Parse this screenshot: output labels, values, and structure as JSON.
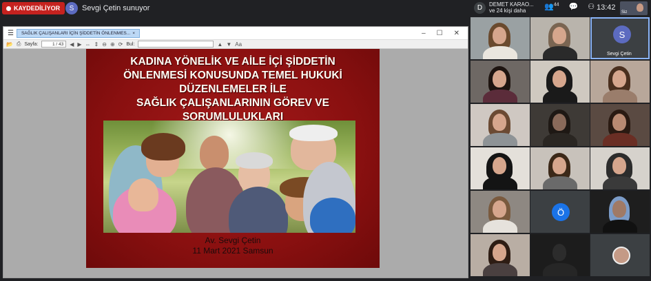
{
  "topbar": {
    "recording_label": "KAYDEDİLİYOR",
    "presenter_initial": "S",
    "presenter_text": "Sevgi Çetin sunuyor",
    "people_initial": "D",
    "people_name": "DEMET KARAO...",
    "people_more": "ve 24 kişi daha",
    "participants_count": "44",
    "clock": "13:42",
    "self_label": "Siz"
  },
  "viewer_window": {
    "tab_title": "SAĞLIK ÇALIŞANLARI İÇİN ŞİDDETİN ÖNLENMES...",
    "page_label": "Sayfa:",
    "page_value": "1 / 43",
    "find_label": "Bul:"
  },
  "slide": {
    "title_lines": [
      "KADINA YÖNELİK VE  AİLE İÇİ ŞİDDETİN",
      "ÖNLENMESİ KONUSUNDA TEMEL HUKUKİ",
      "DÜZENLEMELER İLE",
      "SAĞLIK ÇALIŞANLARININ GÖREV VE",
      "SORUMLULUKLARI"
    ],
    "author": "Av. Sevgi Çetin",
    "date": "11 Mart 2021 Samsun"
  },
  "tiles": {
    "presenter_initial": "S",
    "presenter_name": "Sevgi Çetin",
    "avatar_o": "Ö"
  },
  "colors": {
    "recording": "#c5221f",
    "slide_bg": "#8f1212",
    "meet_bg": "#202124",
    "avatar_blue": "#1a73e8",
    "avatar_purple": "#5c6bc0"
  }
}
